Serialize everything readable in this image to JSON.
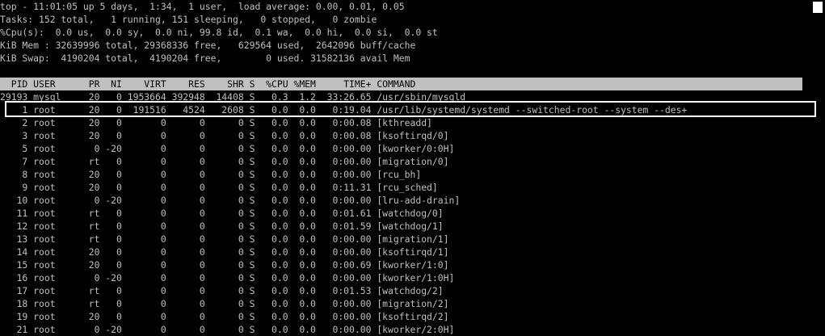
{
  "summary": {
    "uptime_line": "top - 11:01:05 up 5 days,  1:34,  1 user,  load average: 0.00, 0.01, 0.05",
    "tasks_line": "Tasks: 152 total,   1 running, 151 sleeping,   0 stopped,   0 zombie",
    "cpu_line": "%Cpu(s):  0.0 us,  0.0 sy,  0.0 ni, 99.8 id,  0.1 wa,  0.0 hi,  0.0 si,  0.0 st",
    "mem_line": "KiB Mem : 32639996 total, 29368336 free,   629564 used,  2642096 buff/cache",
    "swap_line": "KiB Swap:  4190204 total,  4190204 free,        0 used. 31582136 avail Mem"
  },
  "table": {
    "header": "  PID USER      PR  NI    VIRT    RES    SHR S  %CPU %MEM     TIME+ COMMAND",
    "rows": [
      "29193 mysql     20   0 1953664 392948  14408 S   0.3  1.2  33:26.65 /usr/sbin/mysqld",
      "    1 root      20   0  191516   4524   2608 S   0.0  0.0   0:19.04 /usr/lib/systemd/systemd --switched-root --system --des+",
      "    2 root      20   0       0      0      0 S   0.0  0.0   0:00.08 [kthreadd]",
      "    3 root      20   0       0      0      0 S   0.0  0.0   0:00.08 [ksoftirqd/0]",
      "    5 root       0 -20       0      0      0 S   0.0  0.0   0:00.00 [kworker/0:0H]",
      "    7 root      rt   0       0      0      0 S   0.0  0.0   0:00.00 [migration/0]",
      "    8 root      20   0       0      0      0 S   0.0  0.0   0:00.00 [rcu_bh]",
      "    9 root      20   0       0      0      0 S   0.0  0.0   0:11.31 [rcu_sched]",
      "   10 root       0 -20       0      0      0 S   0.0  0.0   0:00.00 [lru-add-drain]",
      "   11 root      rt   0       0      0      0 S   0.0  0.0   0:01.61 [watchdog/0]",
      "   12 root      rt   0       0      0      0 S   0.0  0.0   0:01.59 [watchdog/1]",
      "   13 root      rt   0       0      0      0 S   0.0  0.0   0:00.00 [migration/1]",
      "   14 root      20   0       0      0      0 S   0.0  0.0   0:00.00 [ksoftirqd/1]",
      "   15 root      20   0       0      0      0 S   0.0  0.0   0:00.69 [kworker/1:0]",
      "   16 root       0 -20       0      0      0 S   0.0  0.0   0:00.00 [kworker/1:0H]",
      "   17 root      rt   0       0      0      0 S   0.0  0.0   0:01.53 [watchdog/2]",
      "   18 root      rt   0       0      0      0 S   0.0  0.0   0:00.00 [migration/2]",
      "   19 root      20   0       0      0      0 S   0.0  0.0   0:00.00 [ksoftirqd/2]",
      "   21 root       0 -20       0      0      0 S   0.0  0.0   0:00.00 [kworker/2:0H]"
    ]
  },
  "colors": {
    "background": "#000000",
    "text": "#c0c0c0",
    "header_background": "#c0c0c0",
    "header_text": "#000000",
    "highlight_border": "#ffffff"
  }
}
